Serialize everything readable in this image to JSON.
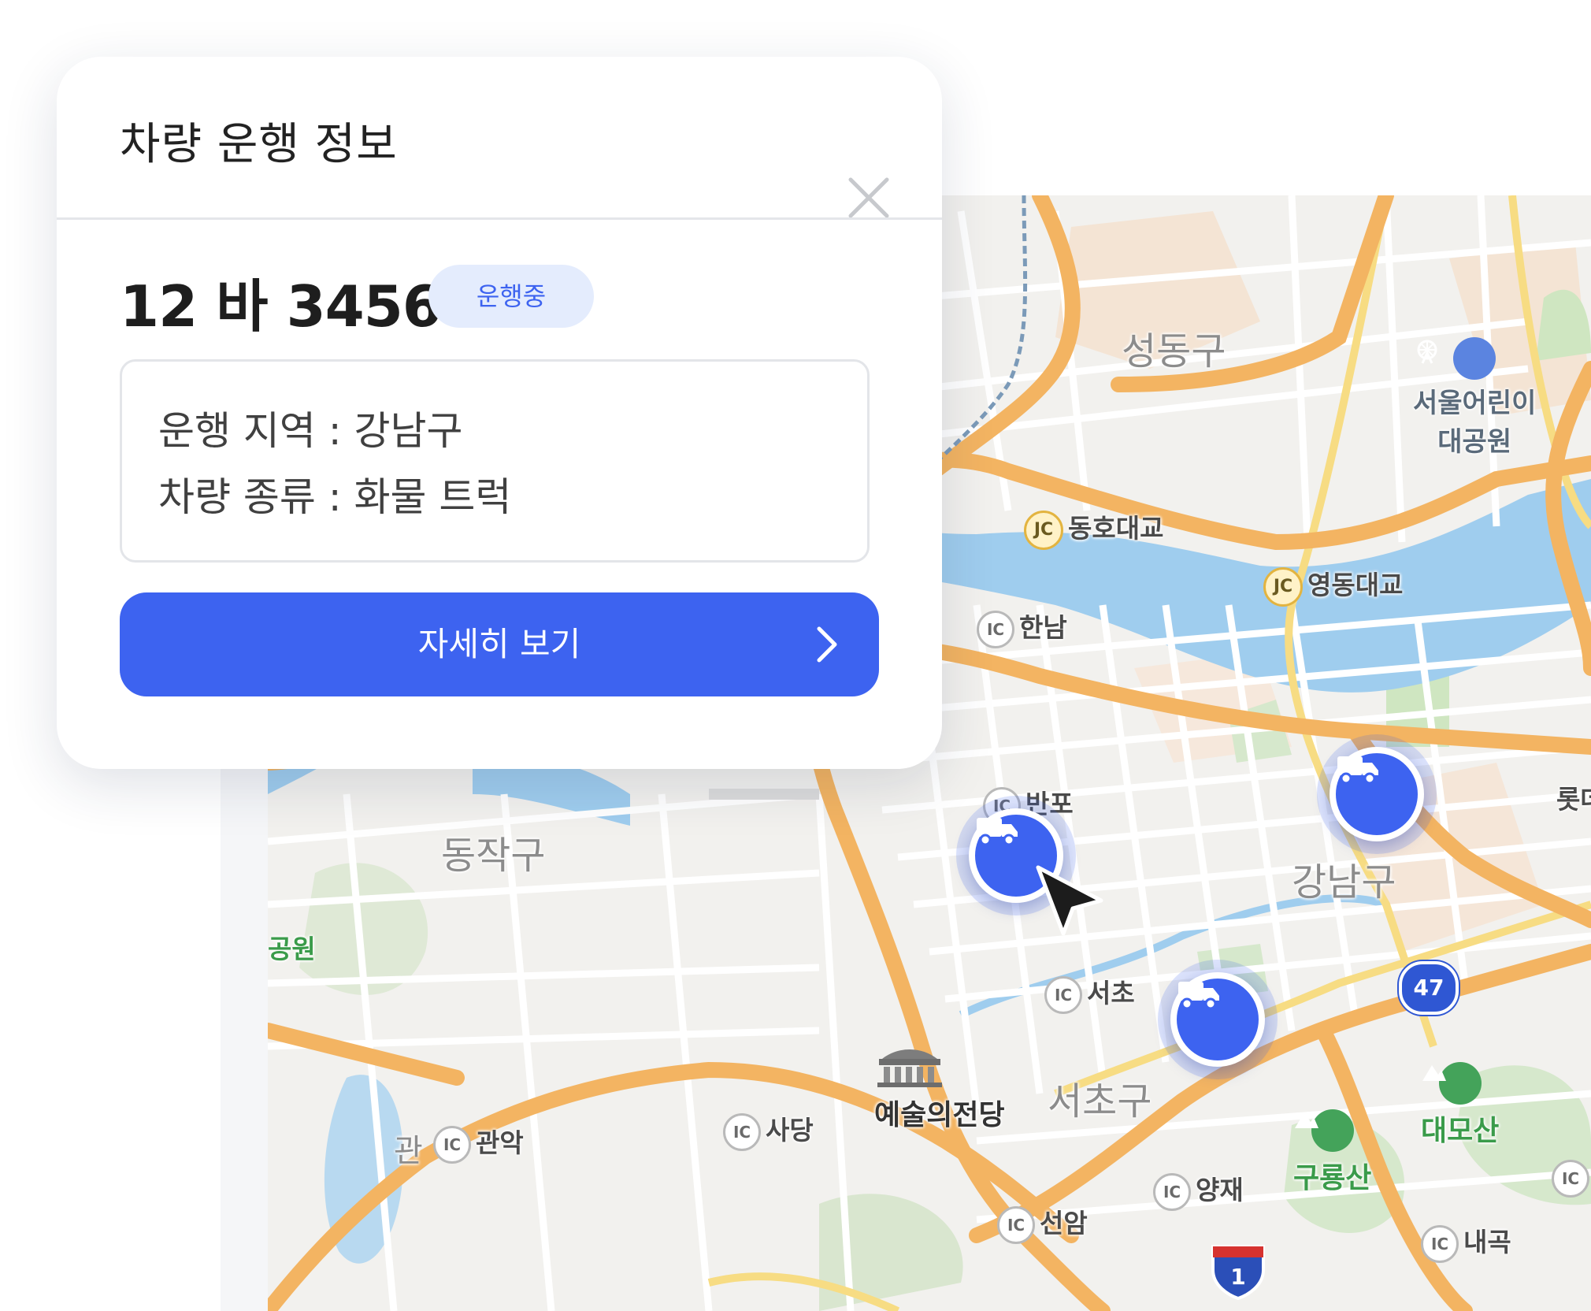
{
  "map": {
    "districts": [
      "성동구",
      "강남구",
      "동작구",
      "서초구"
    ],
    "places": [
      {
        "name": "서울어린이",
        "line2": "대공원",
        "icon": "amusement-park-icon"
      },
      {
        "name": "예술의전당",
        "icon": "concert-hall-icon"
      },
      {
        "name": "대모산",
        "icon": "mountain-icon"
      },
      {
        "name": "구룡산",
        "icon": "mountain-icon"
      }
    ],
    "interchanges": {
      "jc_label": "JC",
      "ic_label": "IC",
      "jc": [
        "동호대교",
        "영동대교"
      ],
      "ic": [
        "한남",
        "반포",
        "서초",
        "사당",
        "관악",
        "선암",
        "양재",
        "내곡"
      ]
    },
    "partial_labels": {
      "left_park": "공원",
      "left_gwan": "관",
      "right_lotte": "롯데"
    },
    "route_shields": {
      "highway_1": "1",
      "route_47": "47"
    },
    "vehicle_markers": [
      {
        "name": "vehicle-marker-selected",
        "icon": "truck-icon"
      },
      {
        "name": "vehicle-marker",
        "icon": "truck-icon"
      },
      {
        "name": "vehicle-marker",
        "icon": "truck-icon"
      }
    ]
  },
  "popup": {
    "title": "차량 운행 정보",
    "close_icon": "close-icon",
    "plate": "12 바 3456",
    "status": "운행중",
    "info": {
      "region_label": "운행 지역 : 강남구",
      "type_label": "차량 종류 : 화물 트럭"
    },
    "detail_button": "자세히 보기",
    "detail_icon": "chevron-right-icon"
  },
  "colors": {
    "accent": "#3d63f0",
    "badge_bg": "#e4ecfd",
    "water": "#9fcdee",
    "highway": "#f3b462",
    "park": "#cfe6c1"
  }
}
